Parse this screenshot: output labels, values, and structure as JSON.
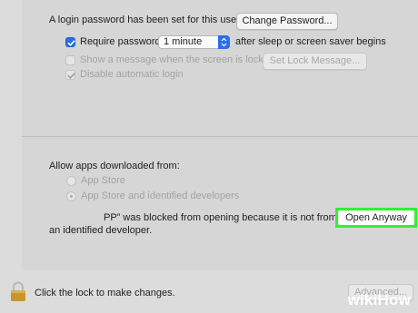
{
  "security": {
    "login_password_text": "A login password has been set for this user",
    "change_password_label": "Change Password...",
    "require_password_label": "Require password",
    "require_password_checked": true,
    "interval_value": "1 minute",
    "after_sleep_text": "after sleep or screen saver begins",
    "show_message_label": "Show a message when the screen is locked",
    "show_message_checked": false,
    "set_lock_message_label": "Set Lock Message...",
    "disable_auto_login_label": "Disable automatic login",
    "disable_auto_login_checked": true
  },
  "downloads": {
    "heading": "Allow apps downloaded from:",
    "options": [
      {
        "label": "App Store",
        "selected": false
      },
      {
        "label": "App Store and identified developers",
        "selected": true
      }
    ],
    "blocked_line1": "PP” was blocked from opening because it is not from",
    "blocked_line2": "an identified developer.",
    "open_anyway_label": "Open Anyway"
  },
  "footer": {
    "lock_text": "Click the lock to make changes.",
    "advanced_label": "Advanced...",
    "lock_icon": "lock-icon"
  },
  "watermark": {
    "part1": "wiki",
    "part2": "How"
  },
  "colors": {
    "accent": "#2a6ee8",
    "highlight": "#30f230"
  }
}
